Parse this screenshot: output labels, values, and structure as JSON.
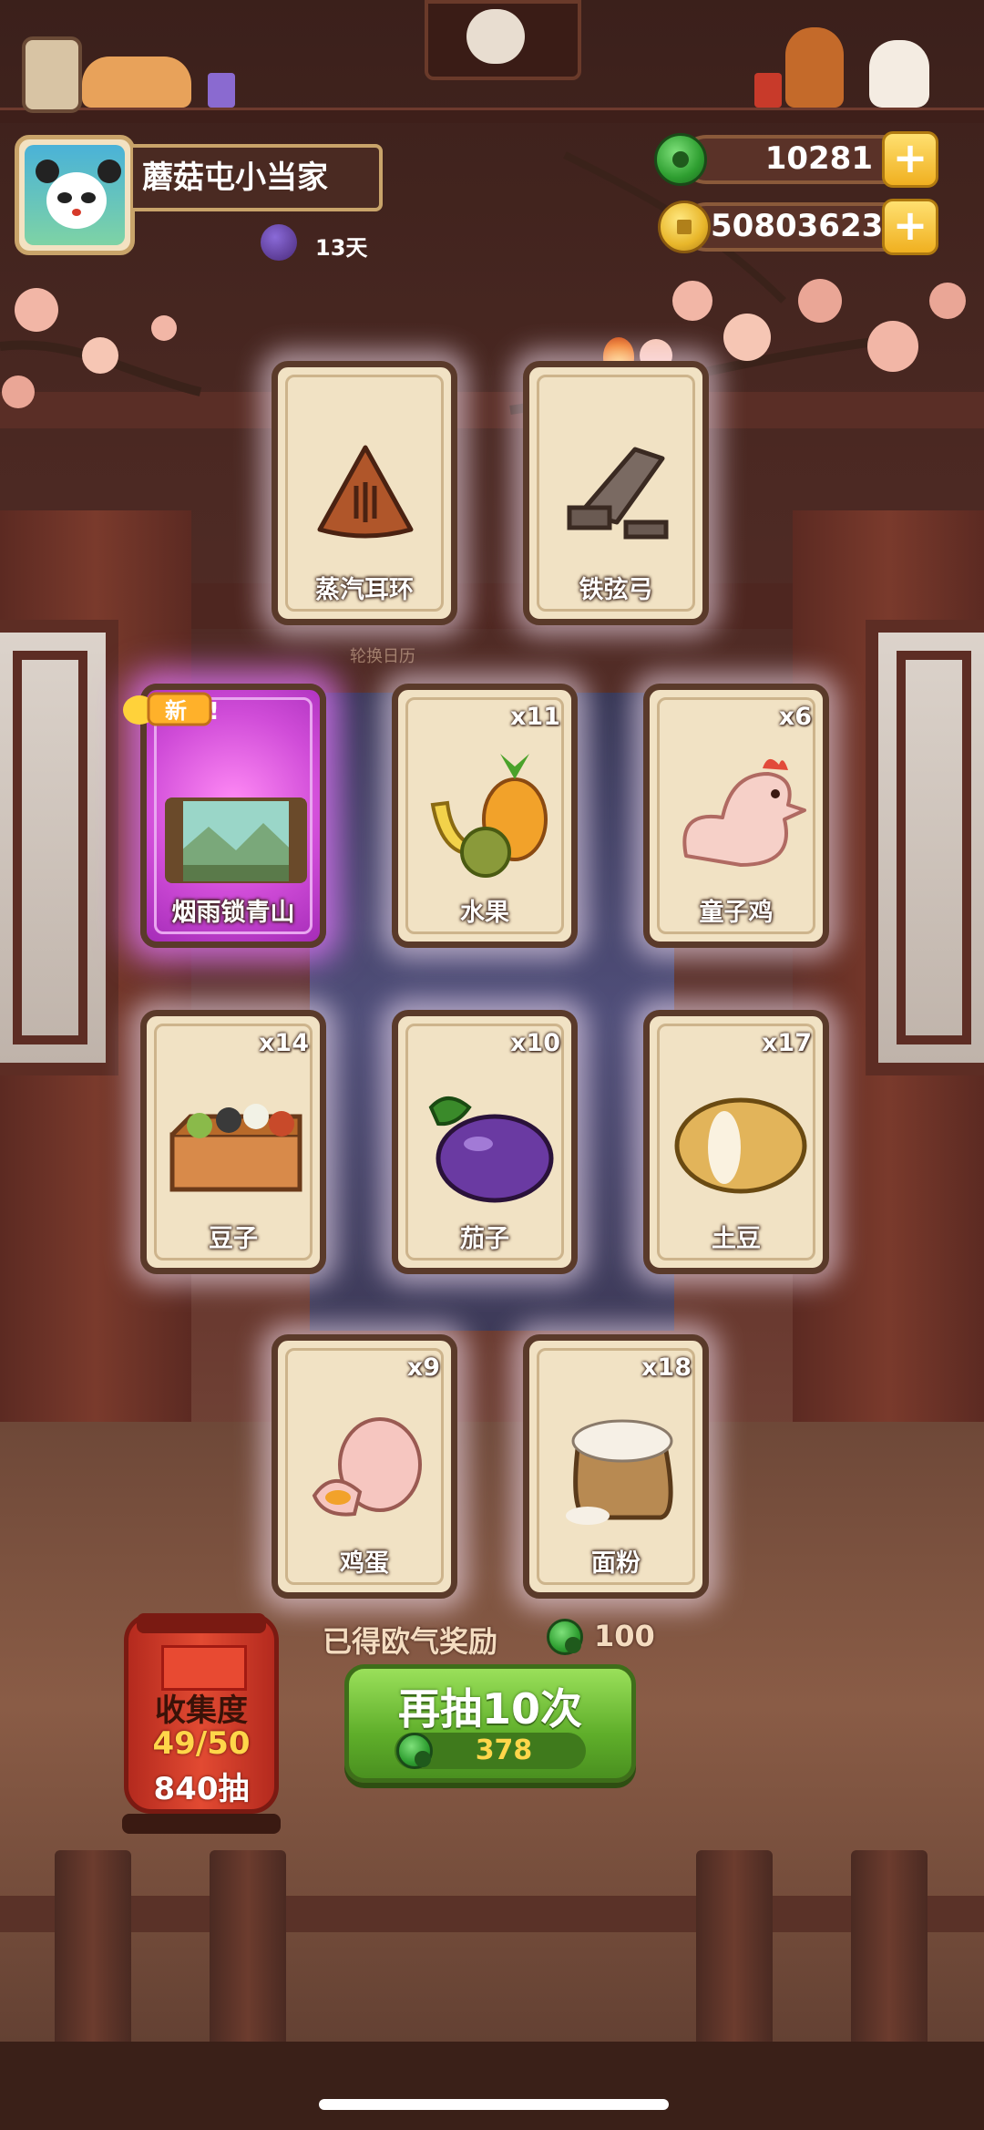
{
  "player": {
    "name": "蘑菇屯小当家",
    "days": "13天"
  },
  "currency": {
    "jade": "10281",
    "coins": "50803623",
    "plus": "+"
  },
  "calendar_label": "轮换日历",
  "cards": [
    {
      "label": "蒸汽耳环",
      "count": "",
      "icon": "earring-icon"
    },
    {
      "label": "铁弦弓",
      "count": "",
      "icon": "iron-bow-icon"
    },
    {
      "label": "烟雨锁青山",
      "count": "",
      "icon": "scenery-icon",
      "badge": "新"
    },
    {
      "label": "水果",
      "count": "x11",
      "icon": "fruit-icon"
    },
    {
      "label": "童子鸡",
      "count": "x6",
      "icon": "chicken-icon"
    },
    {
      "label": "豆子",
      "count": "x14",
      "icon": "beans-icon"
    },
    {
      "label": "茄子",
      "count": "x10",
      "icon": "eggplant-icon"
    },
    {
      "label": "土豆",
      "count": "x17",
      "icon": "potato-icon"
    },
    {
      "label": "鸡蛋",
      "count": "x9",
      "icon": "egg-icon"
    },
    {
      "label": "面粉",
      "count": "x18",
      "icon": "flour-icon"
    }
  ],
  "reward": {
    "label": "已得欧气奖励",
    "value": "100"
  },
  "draw_button": {
    "label": "再抽10次",
    "cost": "378"
  },
  "collection": {
    "title": "收集度",
    "progress": "49/50",
    "draws": "840抽"
  },
  "colors": {
    "jade_green": "#2e9e30",
    "draw_button_green": "#5fae2a",
    "gold": "#f0b020",
    "special_card_purple": "#d04cd8"
  }
}
